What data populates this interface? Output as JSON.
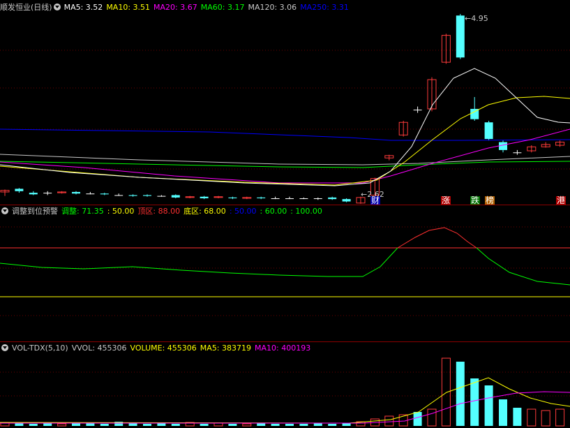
{
  "main": {
    "title": "顺发恒业(日线)",
    "indicators": [
      {
        "label": "MA5: 3.52",
        "color": "#ffffff"
      },
      {
        "label": "MA10: 3.51",
        "color": "#ffff00"
      },
      {
        "label": "MA20: 3.67",
        "color": "#ff00ff"
      },
      {
        "label": "MA60: 3.17",
        "color": "#00ff00"
      },
      {
        "label": "MA120: 3.06",
        "color": "#c8c8c8"
      },
      {
        "label": "MA250: 3.31",
        "color": "#0000ff"
      }
    ],
    "high_label": "4.95",
    "low_label": "2.62",
    "markers": [
      {
        "text": "财",
        "color": "#ffffff",
        "bg": "#0000b0"
      },
      {
        "text": "涨",
        "color": "#ffffff",
        "bg": "#b00000"
      },
      {
        "text": "跌",
        "color": "#ffffff",
        "bg": "#007000"
      },
      {
        "text": "榜",
        "color": "#ffffff",
        "bg": "#b06000"
      },
      {
        "text": "港",
        "color": "#ffffff",
        "bg": "#b00000"
      }
    ]
  },
  "pane2": {
    "title": "调整到位预警",
    "items": [
      {
        "label": "调整: 71.35",
        "color": "#00ff00"
      },
      {
        "label": ": 50.00",
        "color": "#ffff00"
      },
      {
        "label": "顶区: 88.00",
        "color": "#ff3030"
      },
      {
        "label": "底区: 68.00",
        "color": "#ffff00"
      },
      {
        "label": ": 50.00",
        "color": "#0000ff"
      },
      {
        "label": ": 60.00",
        "color": "#00ff00"
      },
      {
        "label": ": 100.00",
        "color": "#00ff00"
      }
    ]
  },
  "pane3": {
    "title": "VOL-TDX(5,10)",
    "items": [
      {
        "label": "VVOL: 455306",
        "color": "#c8c8c8"
      },
      {
        "label": "VOLUME: 455306",
        "color": "#ffff00"
      },
      {
        "label": "MA5: 383719",
        "color": "#ffff00"
      },
      {
        "label": "MA10: 400193",
        "color": "#ff00ff"
      }
    ]
  },
  "colors": {
    "up": "#ff3b3b",
    "down": "#54ffff",
    "flat": "#ffffff",
    "ma5": "#ffffff",
    "ma10": "#ffff00",
    "ma20": "#ff00ff",
    "ma60": "#00ff00",
    "ma120": "#c8c8c8",
    "ma250": "#0000ff",
    "adjust": "#00ff00",
    "adjust_hot": "#ff3030",
    "top_line": "#ff3030",
    "bottom_line": "#ffff00"
  }
}
